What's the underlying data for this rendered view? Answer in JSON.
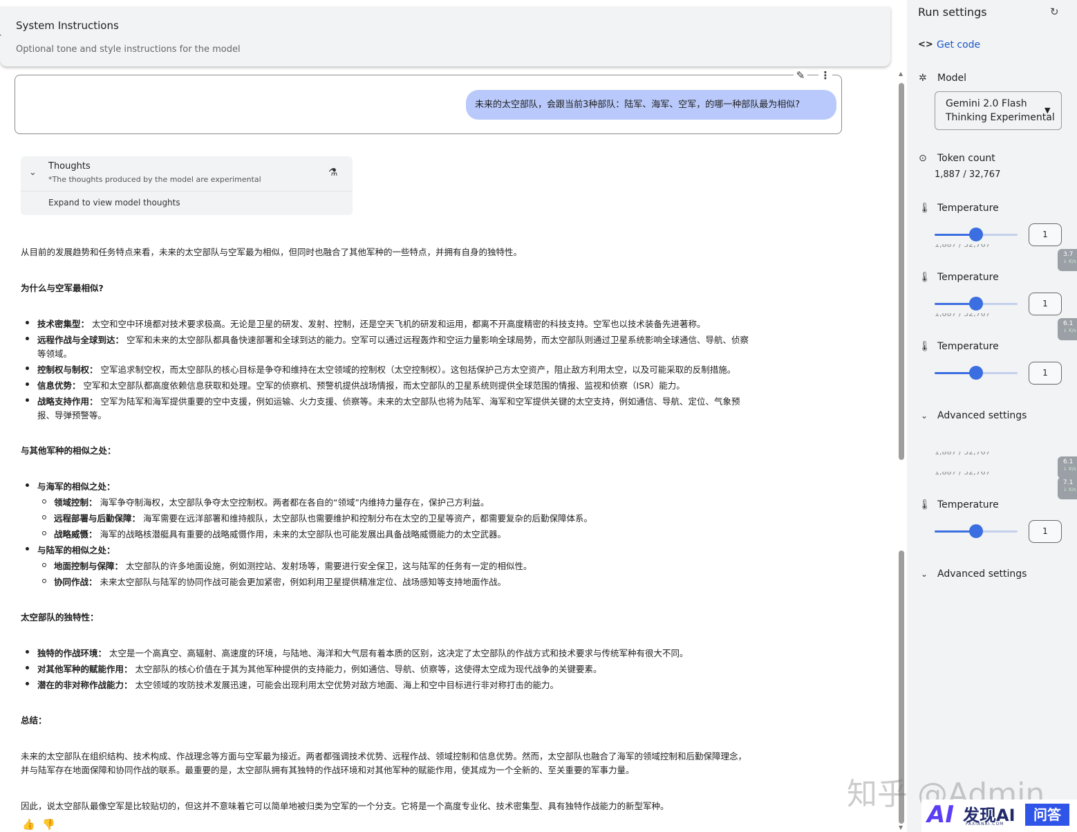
{
  "system_instructions": {
    "title": "System Instructions",
    "subtitle": "Optional tone and style instructions for the model"
  },
  "user_message": "未来的太空部队，会跟当前3种部队：陆军、海军、空军，的哪一种部队最为相似?",
  "thoughts": {
    "title": "Thoughts",
    "subtitle": "*The thoughts produced by the model are experimental",
    "expand": "Expand to view model thoughts"
  },
  "response": {
    "intro": "从目前的发展趋势和任务特点来看，未来的太空部队与空军最为相似，但同时也融合了其他军种的一些特点，并拥有自身的独特性。",
    "h1": "为什么与空军最相似?",
    "list1": [
      {
        "b": "技术密集型：",
        "t": "太空和空中环境都对技术要求极高。无论是卫星的研发、发射、控制，还是空天飞机的研发和运用，都离不开高度精密的科技支持。空军也以技术装备先进著称。"
      },
      {
        "b": "远程作战与全球到达：",
        "t": "空军和未来的太空部队都具备快速部署和全球到达的能力。空军可以通过远程轰炸和空运力量影响全球局势，而太空部队则通过卫星系统影响全球通信、导航、侦察",
        "t2": "等领域。"
      },
      {
        "b": "控制权与制权：",
        "t": "空军追求制空权，而太空部队的核心目标是争夺和维持在太空领域的控制权（太空控制权）。这包括保护己方太空资产，阻止敌方利用太空，以及可能采取的反制措施。"
      },
      {
        "b": "信息优势：",
        "t": "空军和太空部队都高度依赖信息获取和处理。空军的侦察机、预警机提供战场情报，而太空部队的卫星系统则提供全球范围的情报、监视和侦察（ISR）能力。"
      },
      {
        "b": "战略支持作用：",
        "t": "空军为陆军和海军提供重要的空中支援，例如运输、火力支援、侦察等。未来的太空部队也将为陆军、海军和空军提供关键的太空支持，例如通信、导航、定位、气象预",
        "t2": "报、导弹预警等。"
      }
    ],
    "h2": "与其他军种的相似之处：",
    "navy": {
      "b": "与海军的相似之处："
    },
    "navy_items": [
      {
        "b": "领域控制：",
        "t": "海军争夺制海权，太空部队争夺太空控制权。两者都在各自的“领域”内维持力量存在，保护己方利益。"
      },
      {
        "b": "远程部署与后勤保障：",
        "t": "海军需要在远洋部署和维持舰队，太空部队也需要维护和控制分布在太空的卫星等资产，都需要复杂的后勤保障体系。"
      },
      {
        "b": "战略威慑：",
        "t": "海军的战略核潜艇具有重要的战略威慑作用，未来的太空部队也可能发展出具备战略威慑能力的太空武器。"
      }
    ],
    "army": {
      "b": "与陆军的相似之处："
    },
    "army_items": [
      {
        "b": "地面控制与保障：",
        "t": "太空部队的许多地面设施，例如测控站、发射场等，需要进行安全保卫，这与陆军的任务有一定的相似性。"
      },
      {
        "b": "协同作战：",
        "t": "未来太空部队与陆军的协同作战可能会更加紧密，例如利用卫星提供精准定位、战场感知等支持地面作战。"
      }
    ],
    "h3": "太空部队的独特性：",
    "list3": [
      {
        "b": "独特的作战环境：",
        "t": "太空是一个高真空、高辐射、高速度的环境，与陆地、海洋和大气层有着本质的区别，这决定了太空部队的作战方式和技术要求与传统军种有很大不同。"
      },
      {
        "b": "对其他军种的赋能作用：",
        "t": "太空部队的核心价值在于其为其他军种提供的支持能力，例如通信、导航、侦察等，这使得太空成为现代战争的关键要素。"
      },
      {
        "b": "潜在的非对称作战能力：",
        "t": "太空领域的攻防技术发展迅速，可能会出现利用太空优势对敌方地面、海上和空中目标进行非对称打击的能力。"
      }
    ],
    "h4": "总结：",
    "summary1": "未来的太空部队在组织结构、技术构成、作战理念等方面与空军最为接近。两者都强调技术优势、远程作战、领域控制和信息优势。然而，太空部队也融合了海军的领域控制和后勤保障理念，",
    "summary2": "并与陆军存在地面保障和协同作战的联系。最重要的是，太空部队拥有其独特的作战环境和对其他军种的赋能作用，使其成为一个全新的、至关重要的军事力量。",
    "conclusion": "因此，说太空部队最像空军是比较贴切的，但这并不意味着它可以简单地被归类为空军的一个分支。它将是一个高度专业化、技术密集型、具有独特作战能力的新型军种。"
  },
  "run_settings": {
    "title": "Run settings",
    "get_code": "Get code",
    "model_label": "Model",
    "model_line1": "Gemini 2.0 Flash",
    "model_line2": "Thinking Experimental",
    "token_label": "Token count",
    "token_value": "1,887 / 32,767",
    "temperature_label": "Temperature",
    "temperature_value": "1",
    "temperature_fraction": 0.5,
    "advanced_label": "Advanced settings"
  },
  "overlays": {
    "speed1": "3.7",
    "speed2": "6.1",
    "speed3": "6.1",
    "speed4": "7.1",
    "unit": "K/s"
  },
  "watermark": {
    "text": "知乎 @Admin",
    "logo_ai": "AI",
    "logo_name": "发现AI",
    "logo_sub": "FAXIANAI.COM",
    "logo_badge": "问答"
  }
}
